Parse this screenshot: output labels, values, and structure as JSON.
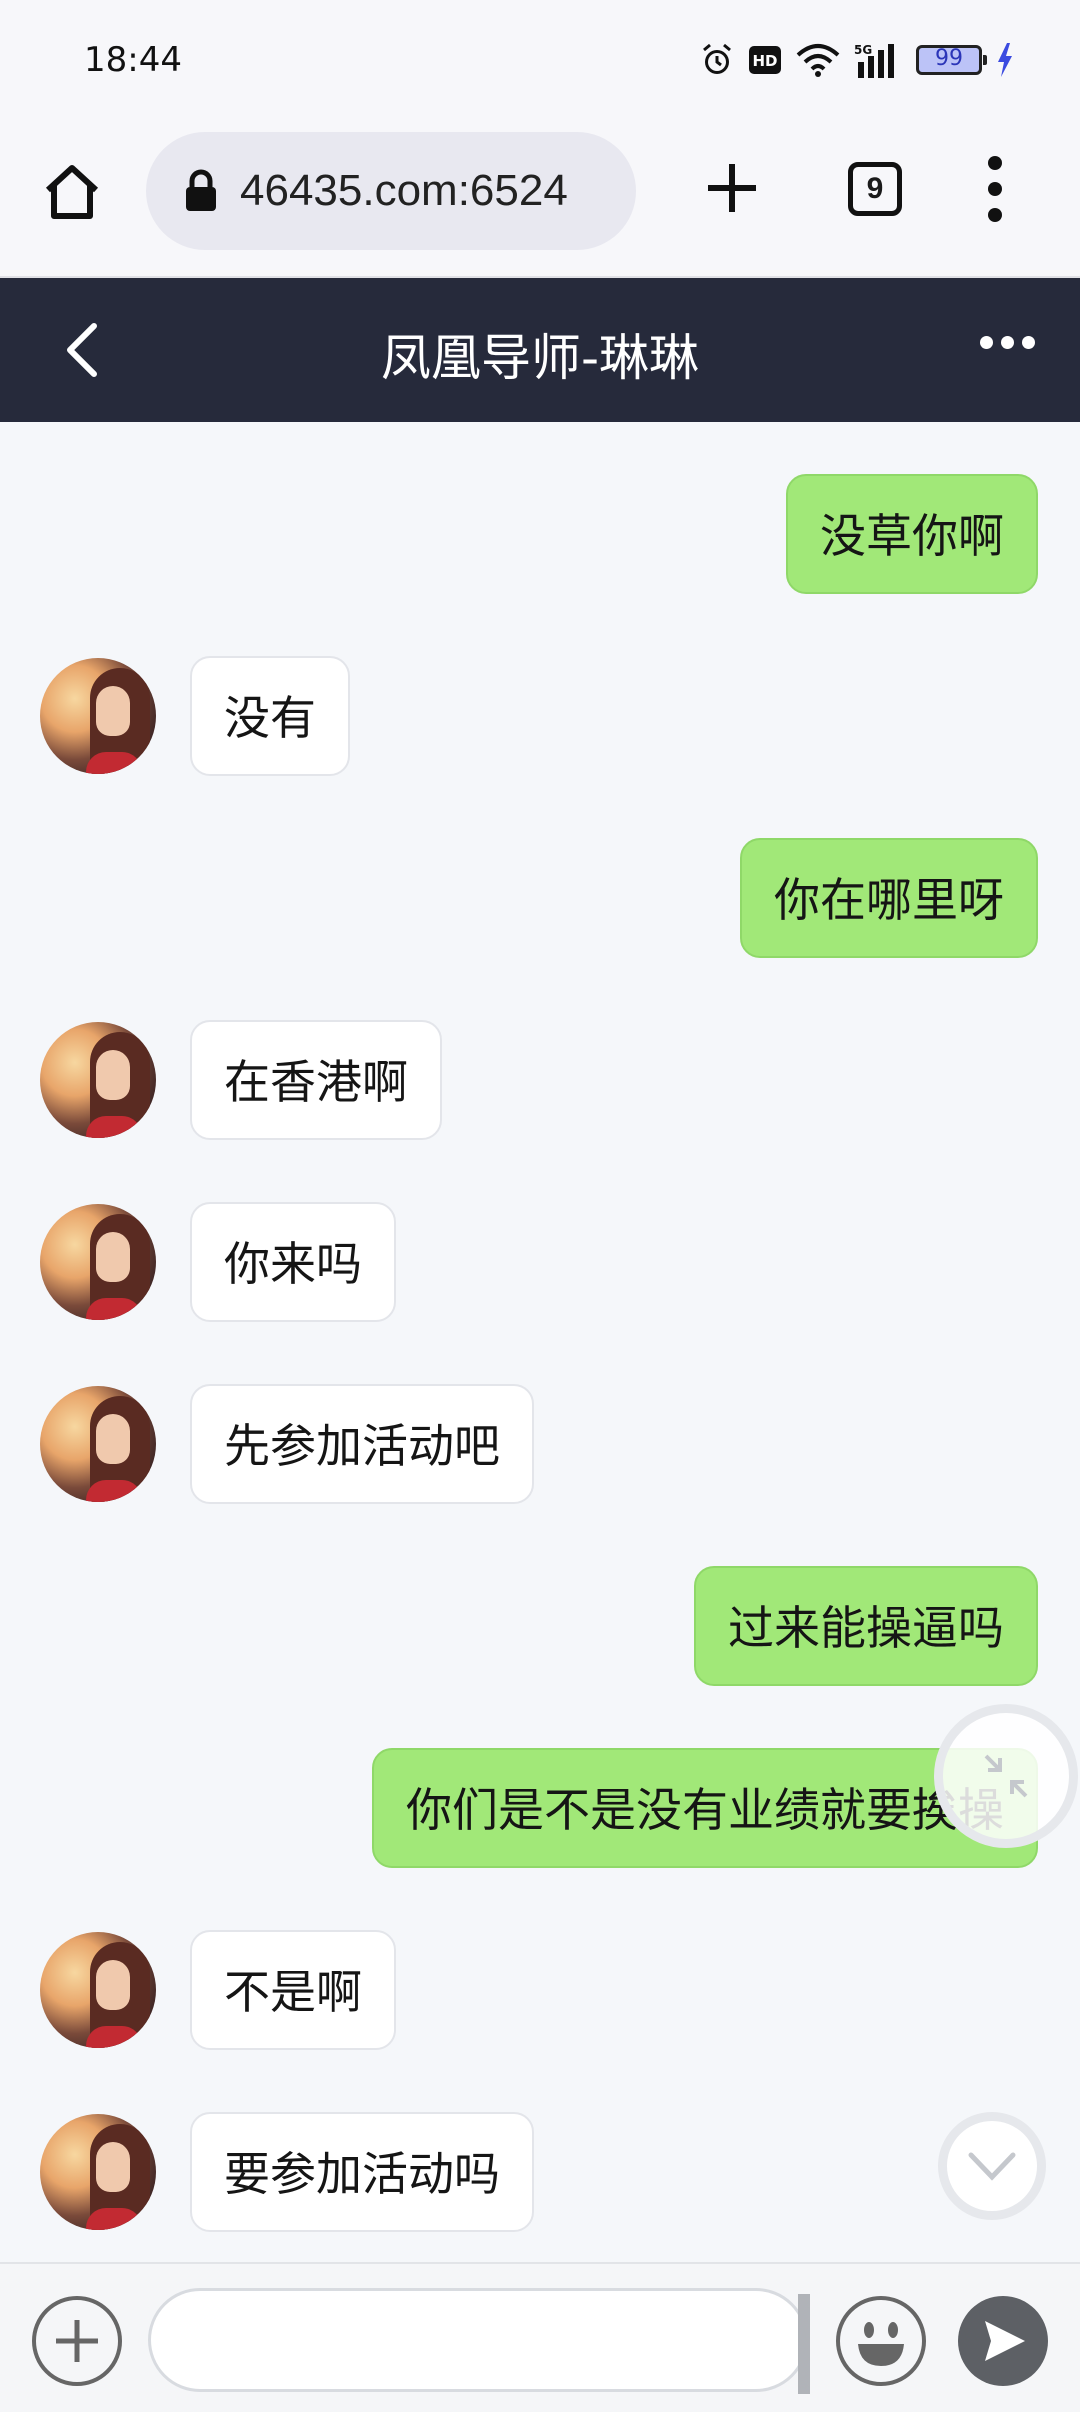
{
  "status_bar": {
    "time": "18:44",
    "network": "5G",
    "battery": "99",
    "icons": [
      "alarm-icon",
      "hd-icon",
      "wifi-icon",
      "signal-icon",
      "battery-icon",
      "charging-icon"
    ]
  },
  "browser": {
    "url": "46435.com:6524",
    "tab_count": "9"
  },
  "chat": {
    "title": "凤凰导师-琳琳",
    "messages": [
      {
        "side": "out",
        "text": "没草你啊"
      },
      {
        "side": "in",
        "text": "没有"
      },
      {
        "side": "out",
        "text": "你在哪里呀"
      },
      {
        "side": "in",
        "text": "在香港啊"
      },
      {
        "side": "in",
        "text": "你来吗"
      },
      {
        "side": "in",
        "text": "先参加活动吧"
      },
      {
        "side": "out",
        "text": "过来能操逼吗"
      },
      {
        "side": "out",
        "text": "你们是不是没有业绩就要挨操"
      },
      {
        "side": "in",
        "text": "不是啊"
      },
      {
        "side": "in",
        "text": "要参加活动吗"
      }
    ]
  },
  "input": {
    "placeholder": ""
  },
  "colors": {
    "header_bg": "#262a3b",
    "outgoing_bubble": "#a1e878",
    "incoming_bubble": "#ffffff",
    "page_bg": "#f5f7fa"
  }
}
